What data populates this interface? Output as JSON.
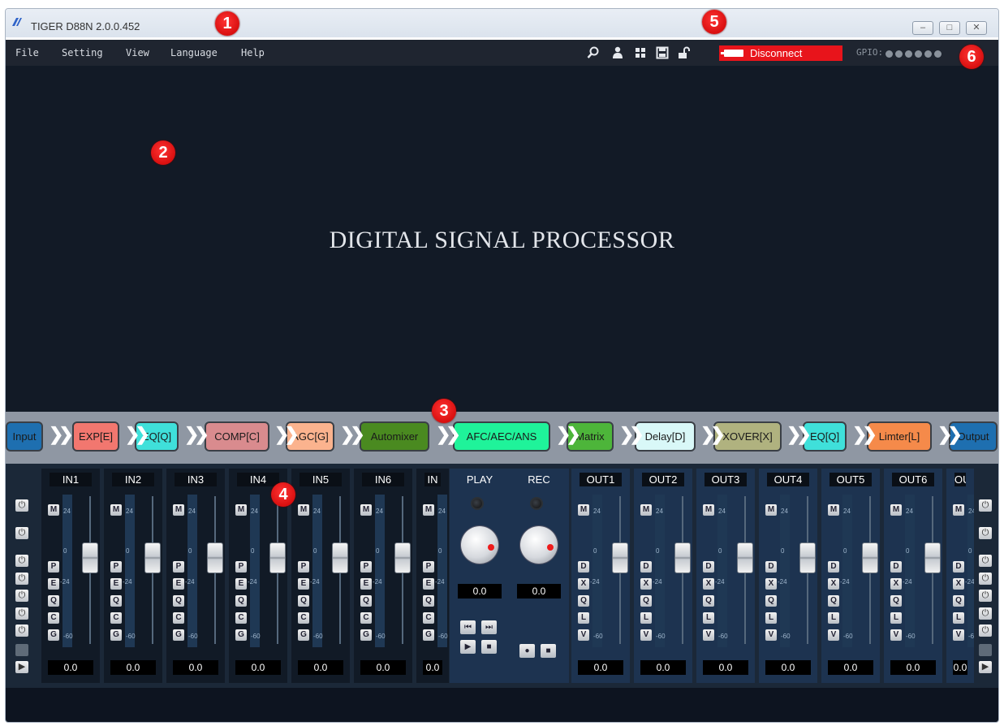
{
  "window": {
    "title": "TIGER D88N 2.0.0.452",
    "controls": [
      "–",
      "□",
      "✕"
    ]
  },
  "menu": [
    "File",
    "Setting",
    "View",
    "Language",
    "Help"
  ],
  "toolbar": {
    "icons": [
      "search-icon",
      "user-icon",
      "grid-icon",
      "save-icon",
      "unlock-icon"
    ],
    "disconnect_label": "Disconnect",
    "gpio_label": "GPIO:",
    "gpio_count": 6
  },
  "workspace": {
    "title": "DIGITAL SIGNAL PROCESSOR"
  },
  "chain": [
    {
      "label": "Input",
      "color": "#1e6fb0"
    },
    {
      "label": "EXP[E]",
      "color": "#f2776f"
    },
    {
      "label": "EQ[Q]",
      "color": "#3fe0da"
    },
    {
      "label": "COMP[C]",
      "color": "#d98b8e"
    },
    {
      "label": "AGC[G]",
      "color": "#fbb38e"
    },
    {
      "label": "Automixer",
      "color": "#4a8a20"
    },
    {
      "label": "AFC/AEC/ANS",
      "color": "#1ff39a"
    },
    {
      "label": "Matrix",
      "color": "#4db53a"
    },
    {
      "label": "Delay[D]",
      "color": "#d9f8f8"
    },
    {
      "label": "XOVER[X]",
      "color": "#b0b27f"
    },
    {
      "label": "EQ[Q]",
      "color": "#3fe0da"
    },
    {
      "label": "Limter[L]",
      "color": "#f58a4a"
    },
    {
      "label": "Output",
      "color": "#1e6fb0"
    }
  ],
  "inputs": {
    "labels": [
      "IN1",
      "IN2",
      "IN3",
      "IN4",
      "IN5",
      "IN6",
      "IN"
    ],
    "values": [
      "0.0",
      "0.0",
      "0.0",
      "0.0",
      "0.0",
      "0.0",
      "0.0"
    ],
    "buttons": [
      "M",
      "P",
      "E",
      "Q",
      "C",
      "G"
    ]
  },
  "outputs": {
    "labels": [
      "OUT1",
      "OUT2",
      "OUT3",
      "OUT4",
      "OUT5",
      "OUT6",
      "OU"
    ],
    "values": [
      "0.0",
      "0.0",
      "0.0",
      "0.0",
      "0.0",
      "0.0",
      "0.0"
    ],
    "buttons": [
      "M",
      "D",
      "X",
      "Q",
      "L",
      "V"
    ]
  },
  "scale": [
    "24",
    "0",
    "-24",
    "-60"
  ],
  "player": {
    "play_label": "PLAY",
    "rec_label": "REC",
    "play_value": "0.0",
    "rec_value": "0.0",
    "play_buttons": [
      "⏮",
      "⏭",
      "▶",
      "■"
    ],
    "rec_buttons": [
      "●",
      "■"
    ]
  },
  "side_buttons": [
    "⏻",
    "⏻",
    "⏻",
    "⏻",
    "⏻",
    "⏻",
    "⏻"
  ],
  "badges": [
    "1",
    "2",
    "3",
    "4",
    "5",
    "6"
  ]
}
